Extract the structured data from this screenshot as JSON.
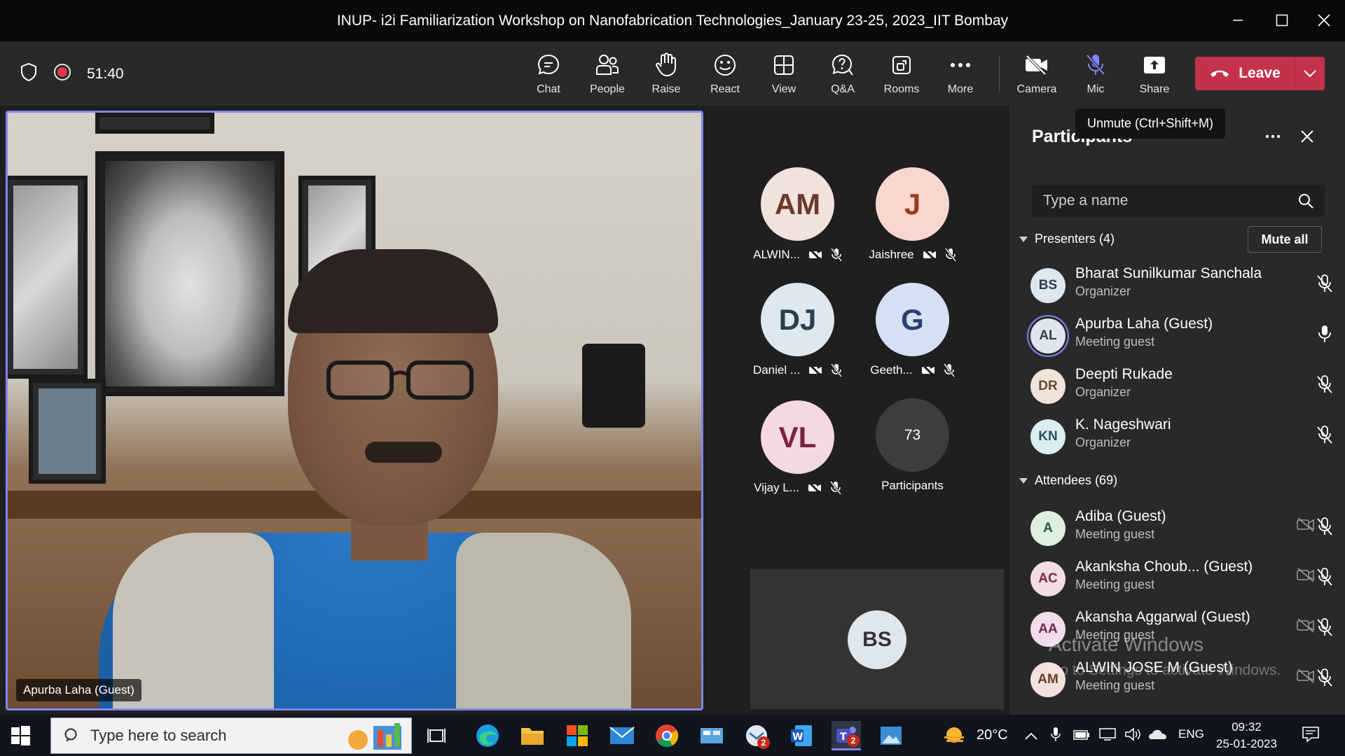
{
  "window": {
    "title": "INUP- i2i Familiarization Workshop on Nanofabrication Technologies_January 23-25, 2023_IIT Bombay"
  },
  "toolbar": {
    "timer": "51:40",
    "buttons": [
      {
        "label": "Chat",
        "icon": "chat-icon"
      },
      {
        "label": "People",
        "icon": "people-icon",
        "active": true
      },
      {
        "label": "Raise",
        "icon": "raise-hand-icon"
      },
      {
        "label": "React",
        "icon": "react-icon"
      },
      {
        "label": "View",
        "icon": "view-icon"
      },
      {
        "label": "Q&A",
        "icon": "qa-icon"
      },
      {
        "label": "Rooms",
        "icon": "rooms-icon"
      },
      {
        "label": "More",
        "icon": "more-icon"
      },
      {
        "label": "Camera",
        "icon": "camera-off-icon"
      },
      {
        "label": "Mic",
        "icon": "mic-off-icon"
      },
      {
        "label": "Share",
        "icon": "share-icon"
      }
    ],
    "leave_label": "Leave",
    "accent_color": "#7f85f5",
    "leave_color": "#c4314b"
  },
  "tooltip": "Unmute (Ctrl+Shift+M)",
  "stage": {
    "main_video_name": "Apurba Laha (Guest)",
    "tiles": [
      {
        "initials": "AM",
        "name": "ALWIN...",
        "bg": "#f1e2dc",
        "fg": "#6b3a2a"
      },
      {
        "initials": "J",
        "name": "Jaishree",
        "bg": "#f7d7cf",
        "fg": "#9b3a22"
      },
      {
        "initials": "DJ",
        "name": "Daniel ...",
        "bg": "#dde8ef",
        "fg": "#2b3f52"
      },
      {
        "initials": "G",
        "name": "Geeth...",
        "bg": "#d6e0f5",
        "fg": "#27406b"
      },
      {
        "initials": "VL",
        "name": "Vijay L...",
        "bg": "#f4d9e1",
        "fg": "#7a2440"
      }
    ],
    "participants_count": "73",
    "participants_label": "Participants",
    "bottom_tile_initials": "BS"
  },
  "panel": {
    "title": "Participants",
    "search_placeholder": "Type a name",
    "presenters_header": "Presenters (4)",
    "mute_all_label": "Mute all",
    "presenters": [
      {
        "initials": "BS",
        "name": "Bharat Sunilkumar Sanchala",
        "role": "Organizer",
        "bg": "#dfe6ec",
        "fg": "#2f3f4e",
        "mic": "mic-off-icon"
      },
      {
        "initials": "AL",
        "name": "Apurba Laha (Guest)",
        "role": "Meeting guest",
        "bg": "#dfe6ec",
        "fg": "#2f3f4e",
        "mic": "mic-on-icon",
        "speaking": true
      },
      {
        "initials": "DR",
        "name": "Deepti Rukade",
        "role": "Organizer",
        "bg": "#efe3da",
        "fg": "#6a4a35",
        "mic": "mic-off-icon"
      },
      {
        "initials": "KN",
        "name": "K. Nageshwari",
        "role": "Organizer",
        "bg": "#dbeef2",
        "fg": "#2a5560",
        "mic": "mic-off-icon"
      }
    ],
    "attendees_header": "Attendees (69)",
    "attendees": [
      {
        "initials": "A",
        "name": "Adiba (Guest)",
        "role": "Meeting guest",
        "bg": "#dcefe0",
        "fg": "#2d5a36"
      },
      {
        "initials": "AC",
        "name": "Akanksha Choub... (Guest)",
        "role": "Meeting guest",
        "bg": "#f4dde2",
        "fg": "#7a2a3a"
      },
      {
        "initials": "AA",
        "name": "Akansha Aggarwal (Guest)",
        "role": "Meeting guest",
        "bg": "#f0dde8",
        "fg": "#6e2a50"
      },
      {
        "initials": "AM",
        "name": "ALWIN JOSE M (Guest)",
        "role": "Meeting guest",
        "bg": "#f1e2dc",
        "fg": "#6b3a2a"
      }
    ]
  },
  "watermark": {
    "line1": "Activate Windows",
    "line2": "Go to Settings to activate Windows."
  },
  "taskbar": {
    "search_placeholder": "Type here to search",
    "weather": "20°C",
    "language": "ENG",
    "time": "09:32",
    "date": "25-01-2023",
    "outlook_badge": "2",
    "teams_badge": "2"
  }
}
